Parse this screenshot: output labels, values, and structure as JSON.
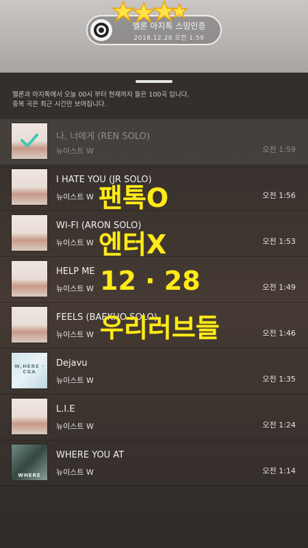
{
  "header": {
    "title": "멜론 아지톡 스밍인증",
    "date": "2018.12.28 오전 1:59"
  },
  "notice": {
    "line1": "멜론과 아지톡에서 오늘 00시 부터 현재까지 들은 100곡 입니다.",
    "line2": "중복 곡은 최근 시간만 보여집니다."
  },
  "tracks": [
    {
      "title": "나, 너에게 (REN SOLO)",
      "artist": "뉴이스트 W",
      "time": "오전 1:59"
    },
    {
      "title": "I HATE YOU (JR SOLO)",
      "artist": "뉴이스트 W",
      "time": "오전 1:56"
    },
    {
      "title": "WI-FI (ARON SOLO)",
      "artist": "뉴이스트 W",
      "time": "오전 1:53"
    },
    {
      "title": "HELP ME",
      "artist": "뉴이스트 W",
      "time": "오전 1:49"
    },
    {
      "title": "FEELS (BAEKHO SOLO)",
      "artist": "뉴이스트 W",
      "time": "오전 1:46"
    },
    {
      "title": "Dejavu",
      "artist": "뉴이스트 W",
      "time": "오전 1:35"
    },
    {
      "title": "L.I.E",
      "artist": "뉴이스트 W",
      "time": "오전 1:24"
    },
    {
      "title": "WHERE YOU AT",
      "artist": "뉴이스트 W",
      "time": "오전 1:14"
    }
  ],
  "album_labels": {
    "dejavu": "W,HERE · CGA",
    "where": "WHERE"
  },
  "overlay": {
    "line1": "팬톡O",
    "line2": "엔터X",
    "line3": "12 · 28",
    "line4": "우리러브들"
  },
  "colors": {
    "overlay_yellow": "#ffea1a",
    "check_teal": "#41c6b5"
  }
}
